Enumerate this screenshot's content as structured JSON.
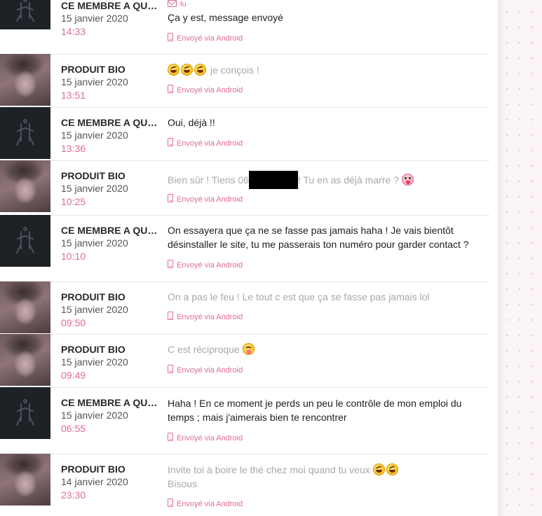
{
  "read_status": "lu",
  "messages": [
    {
      "sender": "CE MEMBRE A QUITTÉ",
      "date": "15 janvier 2020",
      "time": "14:33",
      "text": "Ça y est, message envoyé",
      "device": "Envoyé via Android",
      "avatar": "site-logo"
    },
    {
      "sender": "PRODUIT BIO",
      "date": "15 janvier 2020",
      "time": "13:51",
      "text": "je conçois !",
      "device": "Envoyé via Android",
      "avatar": "photo",
      "emojis": [
        "rolling-on-floor-laughing",
        "rolling-on-floor-laughing",
        "rolling-on-floor-laughing"
      ]
    },
    {
      "sender": "CE MEMBRE A QUITTÉ",
      "date": "15 janvier 2020",
      "time": "13:36",
      "text": "Oui, déjà !!",
      "device": "Envoyé via Android",
      "avatar": "site-logo"
    },
    {
      "sender": "PRODUIT BIO",
      "date": "15 janvier 2020",
      "time": "10:25",
      "text_before": "Bien sûr ! Tiens 06",
      "text_after": "! Tu en as déjà marre ?",
      "device": "Envoyé via Android",
      "avatar": "photo",
      "emojis": [
        "tongue-out"
      ]
    },
    {
      "sender": "CE MEMBRE A QUITTÉ",
      "date": "15 janvier 2020",
      "time": "10:10",
      "text": "On essayera que ça ne se fasse pas jamais haha ! Je vais bientôt désinstaller le site, tu me passerais ton numéro pour garder contact ?",
      "device": "Envoyé via Android",
      "avatar": "site-logo"
    },
    {
      "sender": "PRODUIT BIO",
      "date": "15 janvier 2020",
      "time": "09:50",
      "text": "On a pas le feu ! Le tout c est que ça se fasse pas jamais lol",
      "device": "Envoyé via Android",
      "avatar": "photo"
    },
    {
      "sender": "PRODUIT BIO",
      "date": "15 janvier 2020",
      "time": "09:49",
      "text": "C est réciproque",
      "device": "Envoyé via Android",
      "avatar": "photo",
      "emojis": [
        "winking-kiss"
      ]
    },
    {
      "sender": "CE MEMBRE A QUITTÉ",
      "date": "15 janvier 2020",
      "time": "06:55",
      "text": "Haha ! En ce moment je perds un peu le contrôle de mon emploi du temps ; mais j'aimerais bien te rencontrer",
      "device": "Envoyé via Android",
      "avatar": "site-logo"
    },
    {
      "sender": "PRODUIT BIO",
      "date": "14 janvier 2020",
      "time": "23:30",
      "text": "Invite toi à boire le thé chez moi quand tu veux",
      "text_line2": "Bisous",
      "device": "Envoyé via Android",
      "avatar": "photo",
      "emojis": [
        "rolling-on-floor-laughing",
        "rolling-on-floor-laughing"
      ]
    }
  ]
}
